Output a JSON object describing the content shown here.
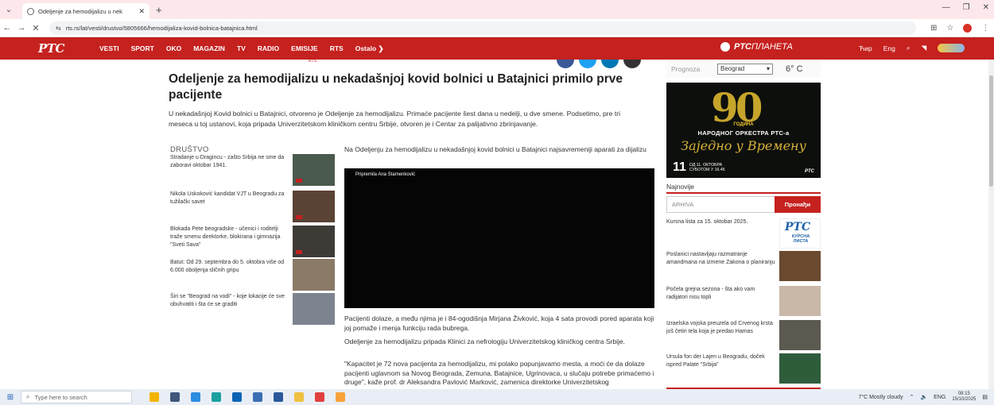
{
  "browser": {
    "tab_title": "Odeljenje za hemodijalizu u nek",
    "tab_close": "✕",
    "new_tab": "+",
    "url": "rts.rs/lat/vesti/drustvo/5805666/hemodijaliza-kovid-bolnica-batajnica.html",
    "win_min": "—",
    "win_restore": "❐",
    "win_close": "✕"
  },
  "site": {
    "logo": "PTC",
    "nav": [
      "VESTI",
      "SPORT",
      "OKO",
      "MAGAZIN",
      "TV",
      "RADIO",
      "EMISIJE",
      "RTS",
      "Ostalo ❯"
    ],
    "planeta_bold": "PTC",
    "planeta_thin": "ПЛАНЕТА",
    "lang_cyr": "Ћир",
    "lang_eng": "Eng",
    "colors": {
      "brand_red": "#c5211f",
      "share_fb": "#3b5998",
      "share_tw": "#1da1f2",
      "share_in": "#0077b5",
      "share_wa": "#333333"
    }
  },
  "article": {
    "rts_tag": "RTS",
    "headline": "Odeljenje za hemodijalizu u nekadašnjoj kovid bolnici u Batajnici primilo prve pacijente",
    "lead": "U nekadašnjoj Kovid bolnici u Batajnici, otvoreno je Odeljenje za hemodijalizu. Primaće pacijente šest dana u nedelji, u dve smene. Podsetimo, pre tri meseca u toj ustanovi, koja pripada Univerzitetskom kliničkom centru Srbije, otvoren je i Centar za palijativno zbrinjavanje.",
    "image_caption": "Na Odeljenju za hemodijalizu u nekadašnjoj kovid bolnici u Batajnici najsavremeniji aparati za dijalizu",
    "video_credit": "Pripremila Ana Stamenković",
    "paragraphs": [
      "Pacijenti dolaze, a među njima je i 84-ogodišnja Mirjana Živković, koja 4 sata provodi pored aparata koji joj pomaže i menja funkciju rada bubrega.",
      "Odeljenje za hemodijalizu pripada Klinici za nefrologiju Univerzitetskog kliničkog centra Srbije.",
      "\"Kapacitet je 72 nova pacijenta za hemodijalizu, mi polako popunjavamo mesta, a moći će da dolaze pacijenti uglavnom sa Novog Beograda, Zemuna, Batajnice, Ugrinovaca, u slučaju potrebe primaćemo i druge\", kaže prof. dr Aleksandra Pavlović Marković, zamenica direktorke Univerzitetskog"
    ]
  },
  "section": {
    "label": "DRUŠTVO",
    "items": [
      {
        "text": "Stradanje u Dragincu - zašto Srbija ne sme da zaboravi oktobar 1941.",
        "thumb": "#4a5a4e"
      },
      {
        "text": "Nikola Uskoković kandidat VJT u Beogradu za tužilački savet",
        "thumb": "#5a4234"
      },
      {
        "text": "Blokada Pete beogradske - učenici i roditelji traže smenu direktorke, blokirana i gimnazija \"Sveti Sava\"",
        "thumb": "#3e3a36"
      },
      {
        "text": "Batut: Od 29. septembra do 5. oktobra više od 6.000 oboljenja sličnih gripu",
        "thumb": "#8a7a66"
      },
      {
        "text": "Širi se \"Beograd na vodi\" - koje lokacije će sve obuhvatiti i šta će se graditi",
        "thumb": "#7d8490"
      }
    ]
  },
  "weather": {
    "label": "Prognoza",
    "city": "Beograd",
    "arrow": "▾",
    "temp": "6° C"
  },
  "promo": {
    "big": "90",
    "godina": "ГОДИНА",
    "orchestra": "НАРОДНОГ ОРКЕСТРА РТС-а",
    "script": "Заједно у Времену",
    "day": "11",
    "date_line1": "ОД 11. ОКТОБРА",
    "date_line2": "СУБОТОМ У 16.45",
    "logo": "PTC"
  },
  "sidebar": {
    "najnovije": "Najnovije",
    "search_placeholder": "ARHIVA",
    "search_button": "Пронађи",
    "news": [
      {
        "text": "Kursna lista za 15. oktobar 2025.",
        "thumb": "kursna"
      },
      {
        "text": "Poslanici nastavljaju razmatranje amandmana na izmene Zakona o planiranju",
        "thumb": "#6b4a2f"
      },
      {
        "text": "Počela grejna sezona - šta ako vam radijatori nisu topli",
        "thumb": "#c9b8a8"
      },
      {
        "text": "Izraelska vojska preuzela od Crvenog krsta još četiri tela koja je predao Hamas",
        "thumb": "#5c5a50"
      },
      {
        "text": "Ursula fon der Lajen u Beogradu, doček ispred Palate \"Srbija\"",
        "thumb": "#2f5d3c"
      }
    ],
    "kursna_logo": "PTC",
    "kursna_text": "КУРСНА ЛИСТА"
  },
  "taskbar": {
    "search_placeholder": "Type here to search",
    "weather": "7°C  Mostly cloudy",
    "lang": "ENG",
    "time": "08:15",
    "date": "15/10/2025"
  }
}
